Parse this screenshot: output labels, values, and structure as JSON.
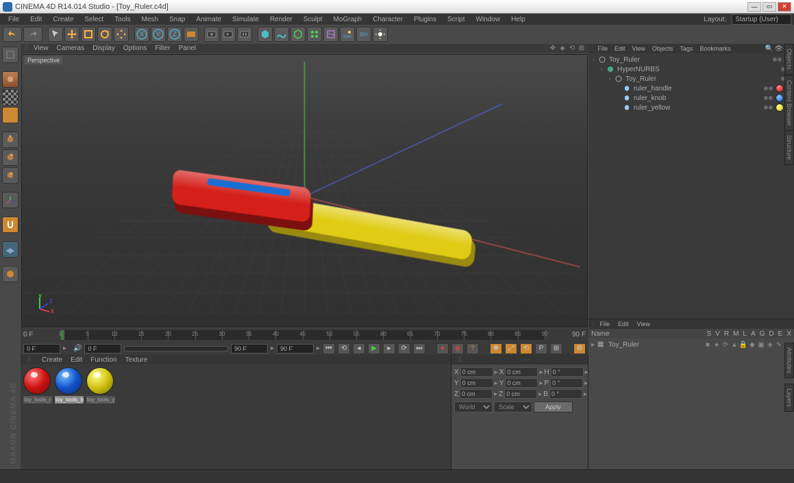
{
  "title": "CINEMA 4D R14.014 Studio - [Toy_Ruler.c4d]",
  "menubar": [
    "File",
    "Edit",
    "Create",
    "Select",
    "Tools",
    "Mesh",
    "Snap",
    "Animate",
    "Simulate",
    "Render",
    "Sculpt",
    "MoGraph",
    "Character",
    "Plugins",
    "Script",
    "Window",
    "Help"
  ],
  "layout_label": "Layout:",
  "layout_value": "Startup (User)",
  "view_menu": [
    "View",
    "Cameras",
    "Display",
    "Options",
    "Filter",
    "Panel"
  ],
  "viewport_label": "Perspective",
  "timeline": {
    "start": 0,
    "end": 90,
    "marks": [
      0,
      5,
      10,
      15,
      20,
      25,
      30,
      35,
      40,
      45,
      50,
      55,
      60,
      65,
      70,
      75,
      80,
      85,
      90
    ],
    "left_f": "0 F",
    "right_f": "90 F"
  },
  "timectl": {
    "cur": "0 F",
    "unk": "0 F",
    "end1": "90 F",
    "end2": "90 F"
  },
  "mat_menu": [
    "Create",
    "Edit",
    "Function",
    "Texture"
  ],
  "materials": [
    {
      "name": "toy_tools_r",
      "color": "red"
    },
    {
      "name": "toy_tools_b",
      "color": "blue",
      "sel": true
    },
    {
      "name": "toy_tools_y",
      "color": "yellow"
    }
  ],
  "coords": {
    "x": "0 cm",
    "y": "0 cm",
    "z": "0 cm",
    "sx": "0 cm",
    "sy": "0 cm",
    "sz": "0 cm",
    "h": "0 °",
    "p": "0 °",
    "b": "0 °",
    "mode1": "World",
    "mode2": "Scale",
    "apply": "Apply"
  },
  "obj_menu": [
    "File",
    "Edit",
    "View",
    "Objects",
    "Tags",
    "Bookmarks"
  ],
  "tree": [
    {
      "depth": 0,
      "tw": "-",
      "icon": "null",
      "name": "Toy_Ruler",
      "dots": true,
      "chk": true
    },
    {
      "depth": 1,
      "tw": "-",
      "icon": "hnurbs",
      "name": "HyperNURBS",
      "dots": true
    },
    {
      "depth": 2,
      "tw": "-",
      "icon": "null",
      "name": "Toy_Ruler",
      "dots": true
    },
    {
      "depth": 3,
      "tw": "",
      "icon": "poly",
      "name": "ruler_handle",
      "dots": true,
      "tag": "red"
    },
    {
      "depth": 3,
      "tw": "",
      "icon": "poly",
      "name": "ruler_knob",
      "dots": true,
      "tag": "blue"
    },
    {
      "depth": 3,
      "tw": "",
      "icon": "poly",
      "name": "ruler_yellow",
      "dots": true,
      "tag": "yellow"
    }
  ],
  "attr_menu": [
    "File",
    "Edit",
    "View"
  ],
  "attr_cols": [
    "Name",
    "S",
    "V",
    "R",
    "M",
    "L",
    "A",
    "G",
    "D",
    "E",
    "X"
  ],
  "attr_item": "Toy_Ruler",
  "watermark": "MAXON CINEMA 4D",
  "vtabs": [
    "Objects",
    "Content Browser",
    "Structure",
    "Attributes",
    "Layers"
  ],
  "colors": {
    "red": "#d41f1a",
    "yellow": "#e0cc15",
    "blue": "#1a6fd4",
    "grid": "#5a5a5a"
  }
}
